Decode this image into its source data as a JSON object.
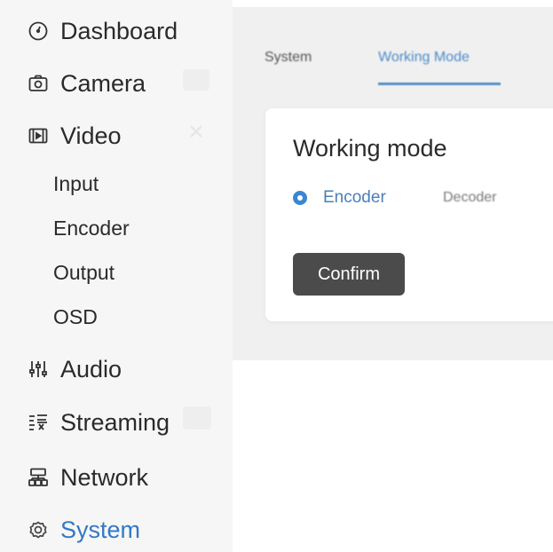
{
  "sidebar": {
    "items": [
      {
        "label": "Dashboard",
        "icon": "dashboard-icon"
      },
      {
        "label": "Camera",
        "icon": "camera-icon"
      },
      {
        "label": "Video",
        "icon": "video-icon"
      },
      {
        "label": "Audio",
        "icon": "audio-icon"
      },
      {
        "label": "Streaming",
        "icon": "streaming-icon"
      },
      {
        "label": "Network",
        "icon": "network-icon"
      },
      {
        "label": "System",
        "icon": "system-icon",
        "active": true
      }
    ],
    "video_subitems": [
      "Input",
      "Encoder",
      "Output",
      "OSD"
    ]
  },
  "tabs": [
    {
      "label": "System"
    },
    {
      "label": "Working Mode",
      "active": true
    }
  ],
  "card": {
    "title": "Working mode",
    "options": [
      {
        "label": "Encoder",
        "selected": true
      },
      {
        "label": "Decoder",
        "selected": false
      }
    ],
    "confirm_label": "Confirm"
  },
  "colors": {
    "accent": "#3378c4",
    "radio": "#3a86d3",
    "button": "#4b4b4b",
    "sidebar_bg": "#f6f6f6",
    "main_bg": "#f0f0f0"
  }
}
